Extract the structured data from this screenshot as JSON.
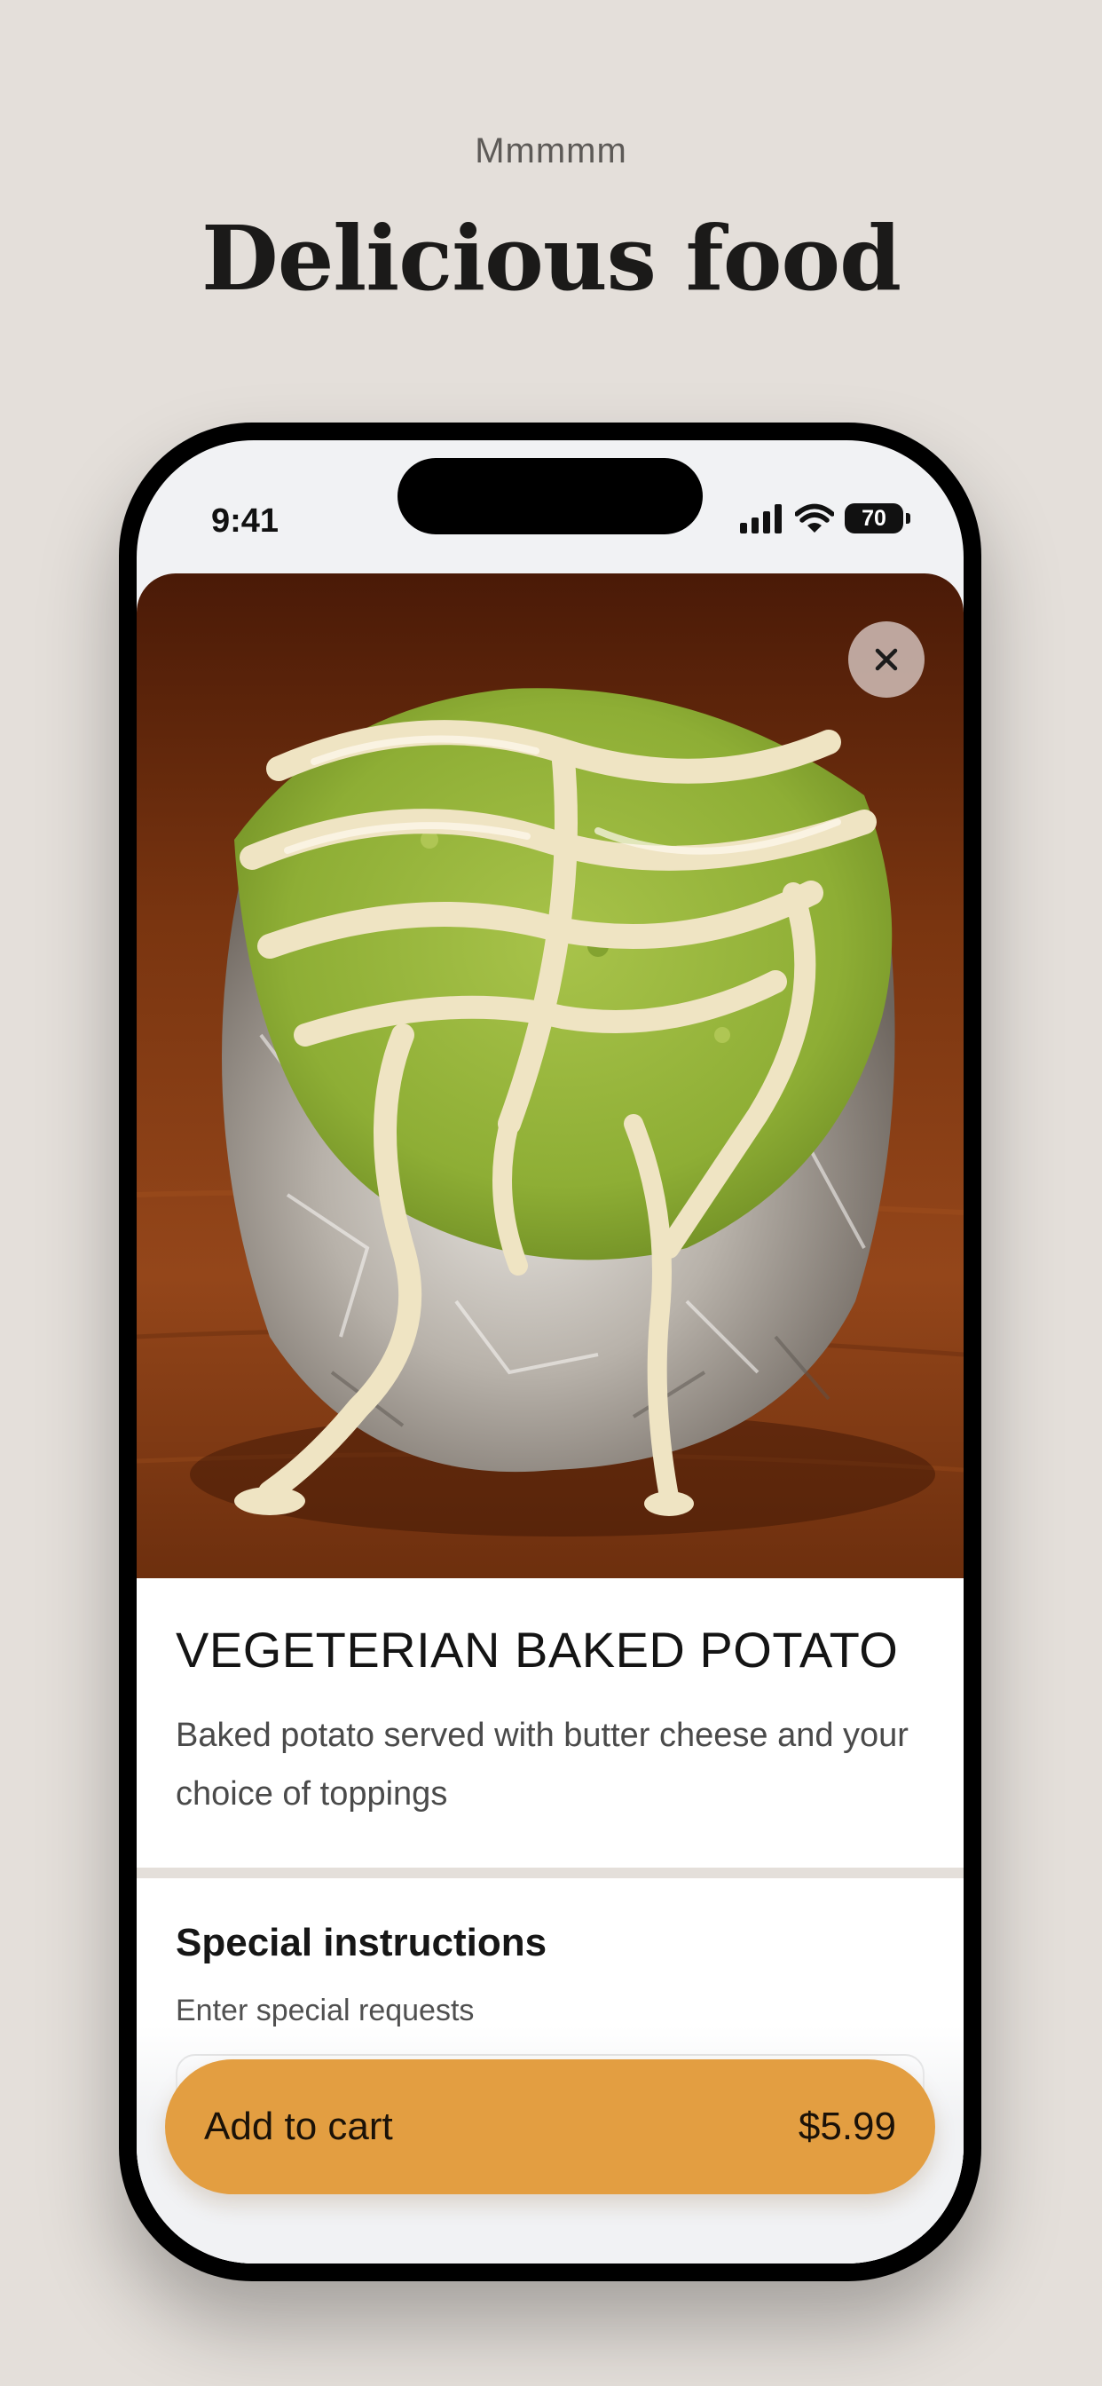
{
  "header": {
    "eyebrow": "Mmmmm",
    "title": "Delicious food"
  },
  "status_bar": {
    "time": "9:41",
    "battery": "70",
    "icons": [
      "cellular-signal-icon",
      "wifi-icon",
      "battery-icon"
    ]
  },
  "product": {
    "image": "baked-potato-photo",
    "close_icon": "close-icon",
    "title": "VEGETERIAN BAKED POTATO",
    "description": "Baked potato served with butter cheese and your choice of toppings"
  },
  "special_instructions": {
    "title": "Special instructions",
    "subtitle": "Enter special requests",
    "value": ""
  },
  "cart": {
    "label": "Add to cart",
    "price": "$5.99"
  },
  "colors": {
    "background": "#e4dfda",
    "accent": "#e39e41",
    "text": "#141414"
  }
}
